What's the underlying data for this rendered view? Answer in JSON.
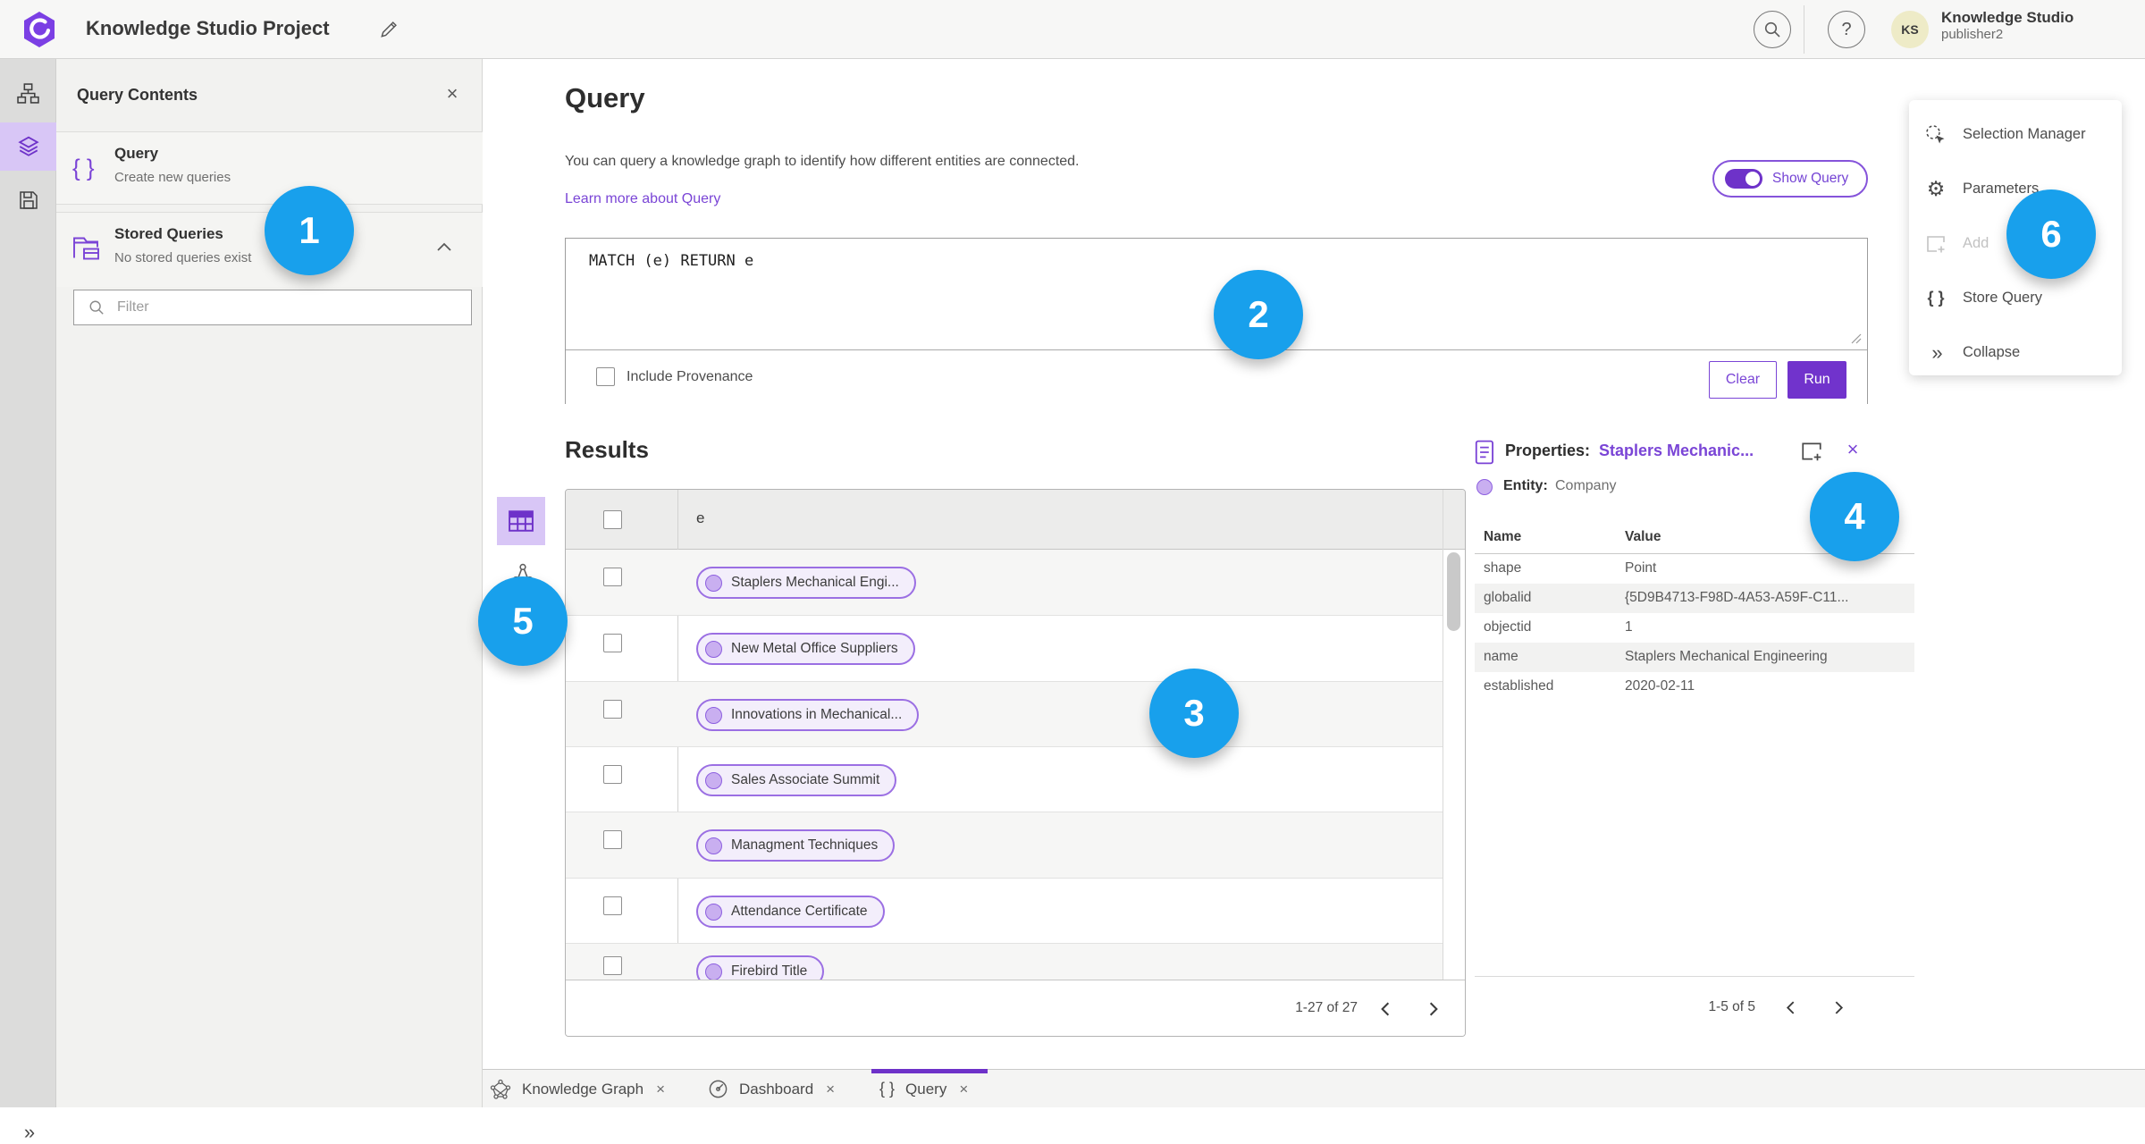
{
  "colors": {
    "accent_purple": "#6e32c9",
    "link_purple": "#7a45d6",
    "pill_purple": "#9b6fe3",
    "callout_blue": "#18a0ec"
  },
  "header": {
    "title": "Knowledge Studio Project",
    "account_name": "Knowledge Studio",
    "account_user": "publisher2",
    "avatar_initials": "KS",
    "help_glyph": "?"
  },
  "panel": {
    "title": "Query Contents",
    "query_label": "Query",
    "query_sublabel": "Create new queries",
    "stored_label": "Stored Queries",
    "stored_sublabel": "No stored queries exist",
    "filter_placeholder": "Filter",
    "close_glyph": "×"
  },
  "query": {
    "heading": "Query",
    "description": "You can query a knowledge graph to identify how different entities are connected.",
    "learn_more": "Learn more about Query",
    "show_query_label": "Show Query",
    "editor_text": "MATCH (e) RETURN e",
    "include_provenance_label": "Include Provenance",
    "clear_label": "Clear",
    "run_label": "Run"
  },
  "results": {
    "heading": "Results",
    "column_header": "e",
    "rows": [
      "Staplers Mechanical Engi...",
      "New Metal Office Suppliers",
      "Innovations in Mechanical...",
      "Sales Associate Summit",
      "Managment Techniques",
      "Attendance Certificate",
      "Firebird Title"
    ],
    "pagination": "1-27 of 27"
  },
  "properties": {
    "title": "Properties:",
    "entity_name": "Staplers Mechanic...",
    "entity_label": "Entity:",
    "entity_type": "Company",
    "col_name": "Name",
    "col_value": "Value",
    "rows": [
      [
        "shape",
        "Point"
      ],
      [
        "globalid",
        "{5D9B4713-F98D-4A53-A59F-C11..."
      ],
      [
        "objectid",
        "1"
      ],
      [
        "name",
        "Staplers Mechanical Engineering"
      ],
      [
        "established",
        "2020-02-11"
      ]
    ],
    "pagination": "1-5 of 5",
    "close_glyph": "×"
  },
  "menu": {
    "items": [
      "Selection Manager",
      "Parameters",
      "Add",
      "Store Query",
      "Collapse"
    ]
  },
  "tabs": [
    "Knowledge Graph",
    "Dashboard",
    "Query"
  ],
  "callouts": [
    "1",
    "2",
    "3",
    "4",
    "5",
    "6"
  ]
}
